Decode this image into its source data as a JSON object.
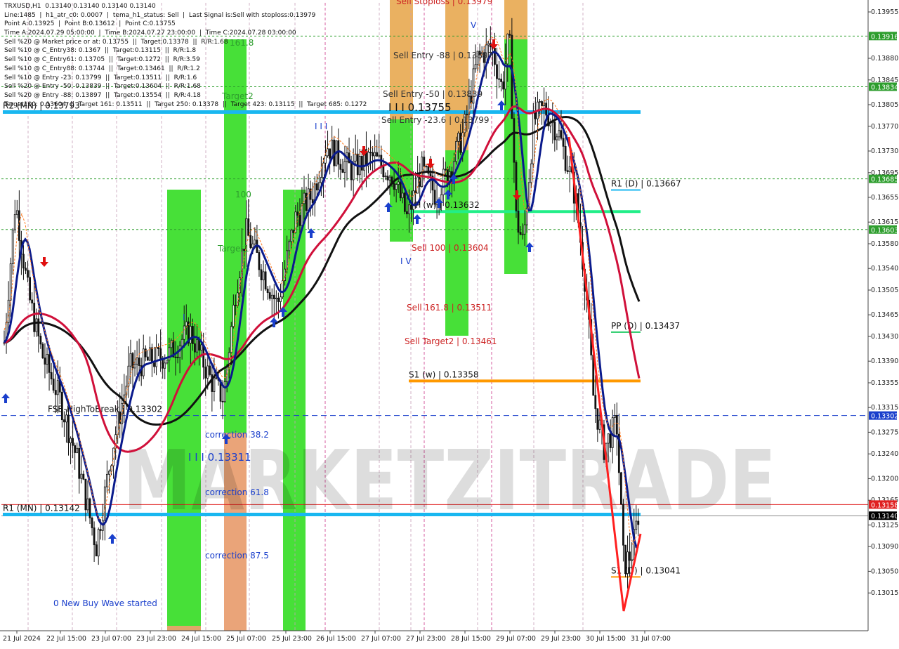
{
  "info_lines": [
    "TRXUSD,H1  0.13140 0.13140 0.13140 0.13140",
    "Line:1485  |  h1_atr_c0: 0.0007  |  tema_h1_status: Sell  |  Last Signal is:Sell with stoploss:0.13979",
    "Point A:0.13925  |  Point B:0.13612  |  Point C:0.13755",
    "Time A:2024.07.29 05:00:00  |  Time B:2024.07.27 23:00:00  |  Time C:2024.07.28 03:00:00",
    "Sell %20 @ Market price or at: 0.13755  ||  Target:0.13378  ||  R/R:1.68",
    "Sell %10 @ C_Entry38: 0.1367  ||  Target:0.13115  ||  R/R:1.8",
    "Sell %10 @ C_Entry61: 0.13705  ||  Target:0.1272  ||  R/R:3.59",
    "Sell %10 @ C_Entry88: 0.13744  ||  Target:0.13461  ||  R/R:1.2",
    "Sell %10 @ Entry -23: 0.13799  ||  Target:0.13511  ||  R/R:1.6",
    "Sell %20 @ Entry -50: 0.13839  ||  Target:0.13604  ||  R/R:1.68",
    "Sell %20 @ Entry -88: 0.13897  ||  Target:0.13554  ||  R/R:4.18",
    "Target100: 0.13604  ||  Target 161: 0.13511  ||  Target 250: 0.13378  ||  Target 423: 0.13115  ||  Target 685: 0.1272"
  ],
  "watermark": "MARKETZITRADE",
  "chart_data": {
    "type": "line",
    "symbol": "TRXUSD",
    "timeframe": "H1",
    "ylim": [
      0.13009,
      0.13975
    ],
    "price_ticks": [
      "0.13955",
      "0.13880",
      "0.13845",
      "0.13805",
      "0.13770",
      "0.13730",
      "0.13695",
      "0.13655",
      "0.13615",
      "0.13580",
      "0.13540",
      "0.13505",
      "0.13465",
      "0.13430",
      "0.13390",
      "0.13355",
      "0.13315",
      "0.13275",
      "0.13240",
      "0.13200",
      "0.13165",
      "0.13125",
      "0.13090",
      "0.13050",
      "0.13015"
    ],
    "x_labels": [
      "21 Jul 2024",
      "22 Jul 15:00",
      "23 Jul 07:00",
      "23 Jul 23:00",
      "24 Jul 15:00",
      "25 Jul 07:00",
      "25 Jul 23:00",
      "26 Jul 15:00",
      "27 Jul 07:00",
      "27 Jul 23:00",
      "28 Jul 15:00",
      "29 Jul 07:00",
      "29 Jul 23:00",
      "30 Jul 15:00",
      "31 Jul 07:00"
    ],
    "price_badges": [
      {
        "value": "0.13916",
        "color": "#2e9e2e"
      },
      {
        "value": "0.13834",
        "color": "#2e9e2e"
      },
      {
        "value": "0.13685",
        "color": "#2e9e2e"
      },
      {
        "value": "0.13603",
        "color": "#2e9e2e"
      },
      {
        "value": "0.13302",
        "color": "#1a3fcc"
      },
      {
        "value": "0.13158",
        "color": "#e02020"
      },
      {
        "value": "0.13140",
        "color": "#000000"
      }
    ],
    "levels": [
      {
        "label": "R2 (MN) | 0.13793",
        "value": 0.13793,
        "color": "#19b7f0",
        "labelColor": "#111111"
      },
      {
        "label": "R1 (MN) | 0.13142",
        "value": 0.13142,
        "color": "#19b7f0",
        "labelColor": "#111111"
      },
      {
        "label": "R1 (D) | 0.13667",
        "value": 0.13667,
        "color": "#19b7f0",
        "labelColor": "#111111"
      },
      {
        "label": "PP (D) | 0.13437",
        "value": 0.13437,
        "color": "#22cc66",
        "labelColor": "#111111"
      },
      {
        "label": "S1 (D) | 0.13041",
        "value": 0.13041,
        "color": "#ff9900",
        "labelColor": "#111111"
      },
      {
        "label": "S1 (w) | 0.13358",
        "value": 0.13358,
        "color": "#ff9900",
        "labelColor": "#111111"
      },
      {
        "label": "PP (w) | 0.13632",
        "value": 0.13632,
        "color": "#22ee88",
        "labelColor": "#111111"
      },
      {
        "label": "FSB-HighToBreak | 0.13302",
        "value": 0.13302,
        "color": "#1a3fcc",
        "labelColor": "#111111"
      }
    ],
    "annotations": [
      {
        "text": "Sell Entry -88 | 0.13897",
        "color": "#333333"
      },
      {
        "text": "Sell Entry -50 | 0.13839",
        "color": "#333333"
      },
      {
        "text": "Sell Entry -23.6 | 0.13799",
        "color": "#333333"
      },
      {
        "text": "I I I  0.13755",
        "color": "#111111"
      },
      {
        "text": "Sell 100 | 0.13604",
        "color": "#cc2222"
      },
      {
        "text": "Sell 161.8 | 0.13511",
        "color": "#cc2222"
      },
      {
        "text": "Sell Target2 | 0.13461",
        "color": "#cc2222"
      },
      {
        "text": "Sell Stoploss | 0.13979",
        "color": "#cc2222"
      },
      {
        "text": "I I I  0.13311",
        "color": "#1a3fcc"
      },
      {
        "text": "correction 38.2",
        "color": "#1a3fcc"
      },
      {
        "text": "correction 61.8",
        "color": "#1a3fcc"
      },
      {
        "text": "correction 87.5",
        "color": "#1a3fcc"
      },
      {
        "text": "0 New Buy Wave started",
        "color": "#1a3fcc"
      },
      {
        "text": "161.8",
        "color": "#2e9e2e"
      },
      {
        "text": "Target2",
        "color": "#2e9e2e"
      },
      {
        "text": "100",
        "color": "#2e9e2e"
      },
      {
        "text": "Target1",
        "color": "#2e9e2e"
      },
      {
        "text": "I",
        "color": "#1a3fcc"
      },
      {
        "text": "I I I",
        "color": "#1a3fcc"
      },
      {
        "text": "V",
        "color": "#1a3fcc"
      },
      {
        "text": "I V",
        "color": "#1a3fcc"
      }
    ],
    "indicators": [
      {
        "name": "fast",
        "color": "#0a1a8c"
      },
      {
        "name": "mid",
        "color": "#d0103a"
      },
      {
        "name": "slow",
        "color": "#111111"
      },
      {
        "name": "wave",
        "color": "#ff2020"
      }
    ],
    "candles_ohlc_sample": [
      [
        0.1342,
        0.13445,
        0.1339,
        0.134
      ],
      [
        0.134,
        0.1369,
        0.1338,
        0.1365
      ],
      [
        0.1365,
        0.1368,
        0.1353,
        0.1356
      ],
      [
        0.1356,
        0.136,
        0.1348,
        0.135
      ],
      [
        0.135,
        0.1351,
        0.133,
        0.1333
      ],
      [
        0.1333,
        0.1334,
        0.1319,
        0.1322
      ],
      [
        0.1322,
        0.1323,
        0.1308,
        0.1312
      ],
      [
        0.1312,
        0.1326,
        0.131,
        0.1324
      ],
      [
        0.1324,
        0.1335,
        0.1323,
        0.1333
      ],
      [
        0.1333,
        0.1342,
        0.1331,
        0.1338
      ],
      [
        0.1338,
        0.1343,
        0.1333,
        0.1339
      ],
      [
        0.1339,
        0.1347,
        0.1337,
        0.134
      ],
      [
        0.134,
        0.1342,
        0.1331,
        0.1335
      ],
      [
        0.1335,
        0.1361,
        0.1334,
        0.1358
      ],
      [
        0.1358,
        0.136,
        0.1348,
        0.1351
      ],
      [
        0.1351,
        0.1365,
        0.135,
        0.1363
      ],
      [
        0.1363,
        0.1375,
        0.1361,
        0.1372
      ],
      [
        0.1372,
        0.1376,
        0.1366,
        0.137
      ],
      [
        0.137,
        0.1374,
        0.1364,
        0.1369
      ],
      [
        0.1369,
        0.1372,
        0.1362,
        0.1365
      ],
      [
        0.1365,
        0.1372,
        0.1362,
        0.137
      ],
      [
        0.137,
        0.139,
        0.1369,
        0.1388
      ],
      [
        0.1388,
        0.1392,
        0.1383,
        0.1386
      ],
      [
        0.1386,
        0.139,
        0.1362,
        0.1365
      ],
      [
        0.1365,
        0.1382,
        0.136,
        0.1378
      ],
      [
        0.1378,
        0.1384,
        0.1372,
        0.1376
      ],
      [
        0.1376,
        0.1379,
        0.1359,
        0.1362
      ],
      [
        0.1362,
        0.1363,
        0.133,
        0.1332
      ],
      [
        0.1332,
        0.1333,
        0.1305,
        0.1307
      ],
      [
        0.1307,
        0.1315,
        0.1305,
        0.1314
      ]
    ]
  }
}
